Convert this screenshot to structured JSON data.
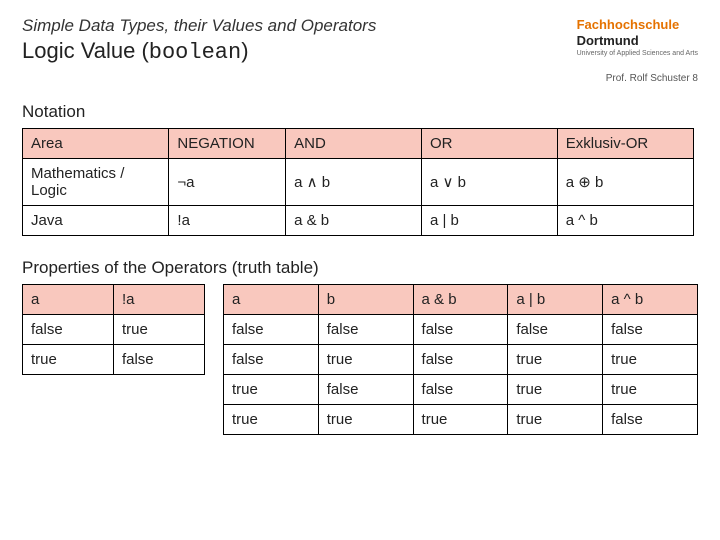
{
  "header": {
    "super_title": "Simple Data Types, their Values and Operators",
    "main_title_prefix": "Logic Value (",
    "main_title_code": "boolean",
    "main_title_suffix": ")",
    "logo_line1": "Fachhochschule",
    "logo_line2": "Dortmund",
    "logo_sub": "University of Applied Sciences and Arts",
    "footer": "Prof. Rolf Schuster   8"
  },
  "notation": {
    "label": "Notation",
    "headers": [
      "Area",
      "NEGATION",
      "AND",
      "OR",
      "Exklusiv-OR"
    ],
    "rows": [
      [
        "Mathematics / Logic",
        "¬a",
        "a ∧ b",
        "a ∨ b",
        "a ⊕ b"
      ],
      [
        "Java",
        "!a",
        "a & b",
        "a | b",
        "a ^ b"
      ]
    ]
  },
  "properties": {
    "label": "Properties of the Operators (truth table)",
    "neg": {
      "headers": [
        "a",
        "!a"
      ],
      "rows": [
        [
          "false",
          "true"
        ],
        [
          "true",
          "false"
        ]
      ]
    },
    "truth": {
      "headers": [
        "a",
        "b",
        "a & b",
        "a | b",
        "a ^ b"
      ],
      "rows": [
        [
          "false",
          "false",
          "false",
          "false",
          "false"
        ],
        [
          "false",
          "true",
          "false",
          "true",
          "true"
        ],
        [
          "true",
          "false",
          "false",
          "true",
          "true"
        ],
        [
          "true",
          "true",
          "true",
          "true",
          "false"
        ]
      ]
    }
  }
}
